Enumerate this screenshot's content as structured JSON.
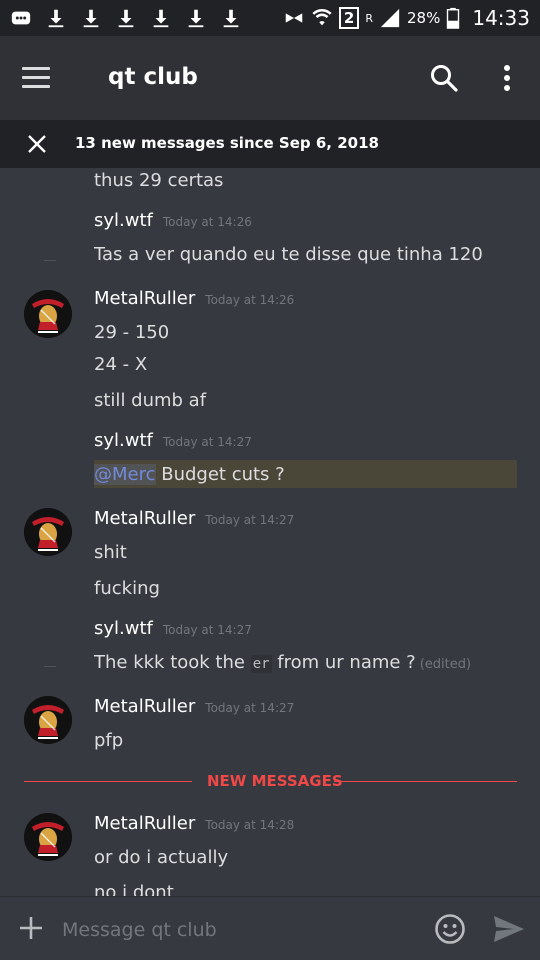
{
  "status_bar": {
    "sim_badge": "2",
    "roaming": "R",
    "battery_percent": "28%",
    "time": "14:33"
  },
  "header": {
    "title": "qt club",
    "icons": [
      "menu-icon",
      "search-icon",
      "more-vertical-icon"
    ]
  },
  "banner": {
    "text": "13 new messages since Sep 6, 2018"
  },
  "messages": [
    {
      "type": "continuation",
      "text": "thus 29 certas"
    },
    {
      "type": "header",
      "author": "syl.wtf",
      "timestamp": "Today at 14:26"
    },
    {
      "type": "continuation",
      "text": "Tas a ver quando eu te disse que tinha 120"
    },
    {
      "type": "header",
      "author": "MetalRuller",
      "timestamp": "Today at 14:26",
      "avatar": true
    },
    {
      "type": "continuation",
      "text": "29 - 150"
    },
    {
      "type": "continuation",
      "text": "24 - X"
    },
    {
      "type": "continuation",
      "text": "still dumb af"
    },
    {
      "type": "header",
      "author": "syl.wtf",
      "timestamp": "Today at 14:27"
    },
    {
      "type": "mention",
      "mention": "@Merc",
      "text": " Budget cuts ?"
    },
    {
      "type": "header",
      "author": "MetalRuller",
      "timestamp": "Today at 14:27",
      "avatar": true
    },
    {
      "type": "continuation",
      "text": "shit"
    },
    {
      "type": "continuation",
      "text": "fucking"
    },
    {
      "type": "header",
      "author": "syl.wtf",
      "timestamp": "Today at 14:27"
    },
    {
      "type": "edited",
      "before": "The kkk took the ",
      "code": "er",
      "after": " from ur name ?",
      "edited_label": "(edited)"
    },
    {
      "type": "header",
      "author": "MetalRuller",
      "timestamp": "Today at 14:27",
      "avatar": true
    },
    {
      "type": "continuation",
      "text": "pfp"
    },
    {
      "type": "header",
      "author": "MetalRuller",
      "timestamp": "Today at 14:28",
      "avatar": true
    },
    {
      "type": "continuation",
      "text": "or do i actually"
    },
    {
      "type": "continuation",
      "text": "no i dont"
    }
  ],
  "divider": {
    "label": "NEW MESSAGES",
    "color": "#f04747"
  },
  "composer": {
    "placeholder": "Message qt club"
  },
  "colors": {
    "background": "#36393f",
    "appbar": "#2f3136",
    "banner": "#202225",
    "mention": "#7289da",
    "mention_row": "#4a4738"
  }
}
